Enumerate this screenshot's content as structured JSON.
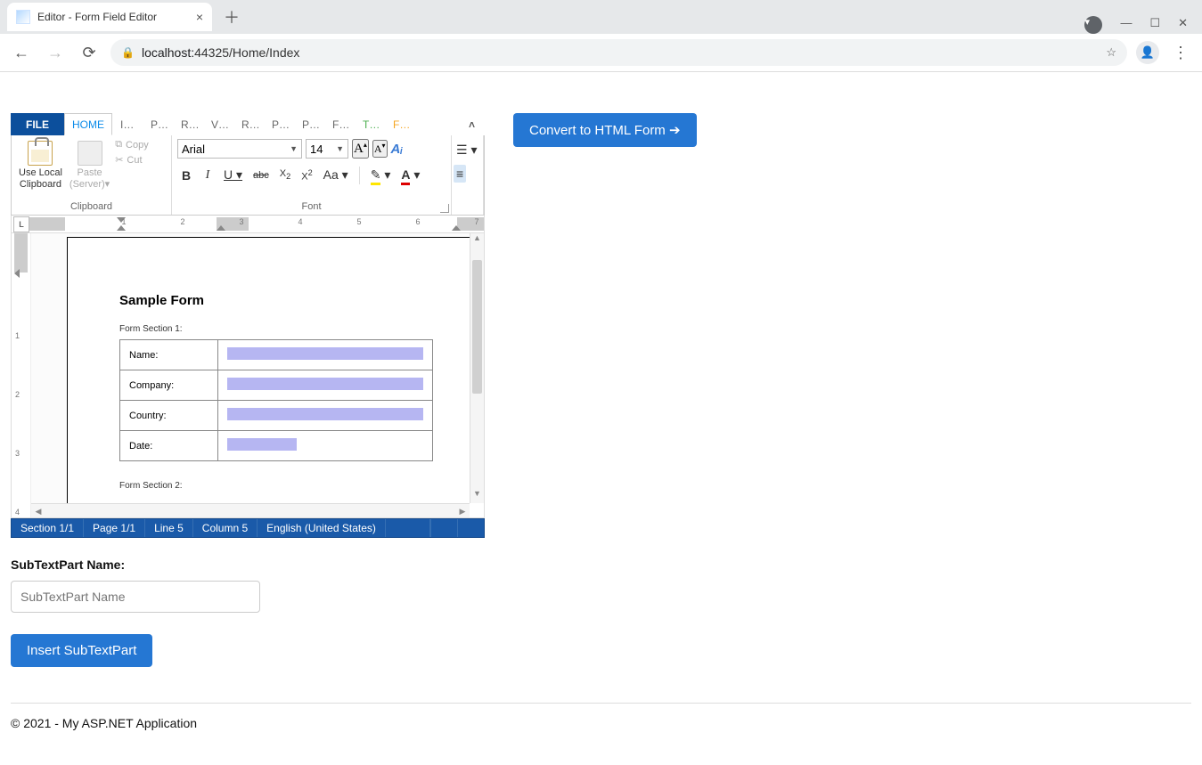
{
  "browser": {
    "tab_title": "Editor - Form Field Editor",
    "url_host": "localhost:",
    "url_port_path": "44325/Home/Index"
  },
  "menubar": {
    "file": "FILE",
    "home": "HOME",
    "items": [
      "I…",
      "P…",
      "R…",
      "V…",
      "R…",
      "P…",
      "P…",
      "F…",
      "T…",
      "F…"
    ]
  },
  "ribbon": {
    "clipboard": {
      "use_local_label": "Use Local\nClipboard",
      "paste_label": "Paste\n(Server)",
      "copy": "Copy",
      "cut": "Cut",
      "group_label": "Clipboard"
    },
    "font": {
      "name": "Arial",
      "size": "14",
      "group_label": "Font"
    }
  },
  "document": {
    "title": "Sample Form",
    "section1_label": "Form Section 1:",
    "section2_label": "Form Section 2:",
    "rows": [
      {
        "label": "Name:",
        "width": "long"
      },
      {
        "label": "Company:",
        "width": "long"
      },
      {
        "label": "Country:",
        "width": "long"
      },
      {
        "label": "Date:",
        "width": "date"
      }
    ]
  },
  "statusbar": {
    "section": "Section 1/1",
    "page": "Page 1/1",
    "line": "Line 5",
    "column": "Column 5",
    "lang": "English (United States)"
  },
  "convert_label": "Convert to HTML Form ➔",
  "subtextpart": {
    "label": "SubTextPart Name:",
    "placeholder": "SubTextPart Name",
    "button": "Insert SubTextPart"
  },
  "footer": "© 2021 - My ASP.NET Application",
  "colors_green": "#4caf50",
  "colors_orange": "#f5a623"
}
